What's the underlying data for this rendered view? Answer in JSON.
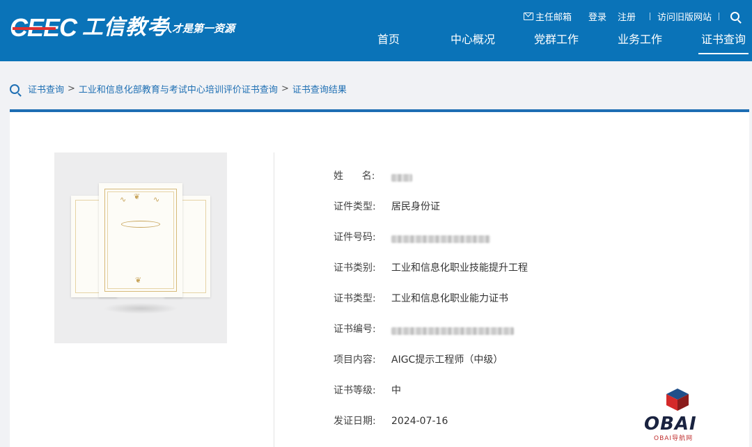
{
  "header": {
    "logo_ceec": "CEEC",
    "logo_cn": "工信教考",
    "slogan": "人才是第一资源",
    "toplinks": {
      "mailbox": "主任邮箱",
      "login": "登录",
      "register": "注册",
      "old_site": "访问旧版网站"
    },
    "nav": [
      {
        "label": "首页"
      },
      {
        "label": "中心概况"
      },
      {
        "label": "党群工作"
      },
      {
        "label": "业务工作"
      },
      {
        "label": "证书查询"
      }
    ],
    "active_nav": "证书查询"
  },
  "breadcrumb": {
    "items": [
      "证书查询",
      "工业和信息化部教育与考试中心培训评价证书查询",
      "证书查询结果"
    ],
    "separator": ">"
  },
  "result": {
    "rows": [
      {
        "label": "姓      名:",
        "value": ""
      },
      {
        "label": "证件类型:",
        "value": "居民身份证"
      },
      {
        "label": "证件号码:",
        "value": ""
      },
      {
        "label": "证书类别:",
        "value": "工业和信息化职业技能提升工程"
      },
      {
        "label": "证书类型:",
        "value": "工业和信息化职业能力证书"
      },
      {
        "label": "证书编号:",
        "value": ""
      },
      {
        "label": "项目内容:",
        "value": "AIGC提示工程师（中级）"
      },
      {
        "label": "证书等级:",
        "value": "中"
      },
      {
        "label": "发证日期:",
        "value": "2024-07-16"
      }
    ]
  },
  "watermark": {
    "brand": "OBAI",
    "sub": "OBAI导航网"
  },
  "colors": {
    "header_bg": "#0a73b8",
    "accent_line": "#1d6db3",
    "link": "#1e6fb3",
    "logo_red": "#e03030"
  }
}
